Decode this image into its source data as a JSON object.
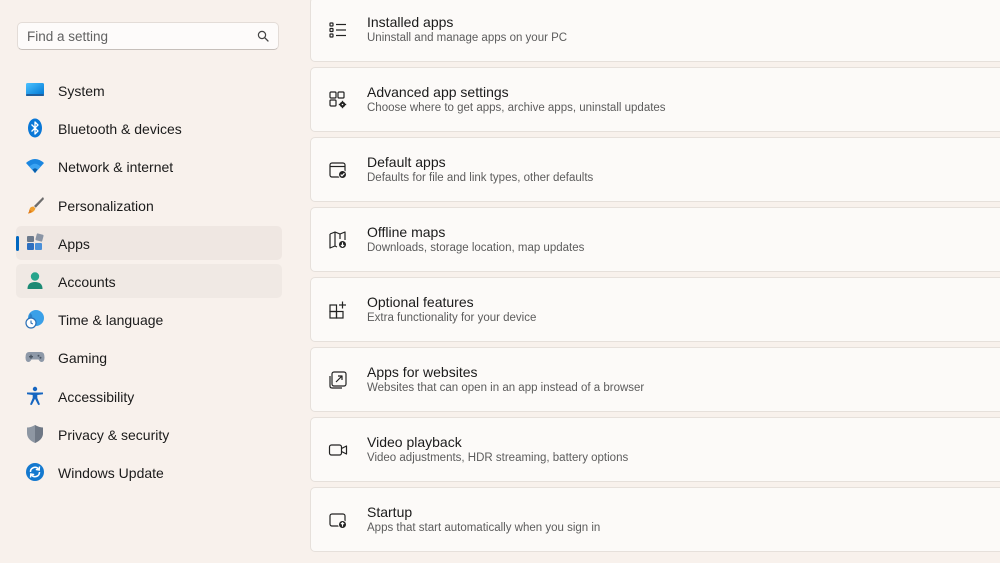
{
  "search": {
    "placeholder": "Find a setting"
  },
  "sidebar": {
    "items": [
      {
        "label": "System",
        "icon": "monitor-icon"
      },
      {
        "label": "Bluetooth & devices",
        "icon": "bluetooth-icon"
      },
      {
        "label": "Network & internet",
        "icon": "wifi-icon"
      },
      {
        "label": "Personalization",
        "icon": "brush-icon"
      },
      {
        "label": "Apps",
        "icon": "apps-icon",
        "selected": true
      },
      {
        "label": "Accounts",
        "icon": "person-icon"
      },
      {
        "label": "Time & language",
        "icon": "globe-clock-icon"
      },
      {
        "label": "Gaming",
        "icon": "gamepad-icon"
      },
      {
        "label": "Accessibility",
        "icon": "accessibility-icon"
      },
      {
        "label": "Privacy & security",
        "icon": "shield-icon"
      },
      {
        "label": "Windows Update",
        "icon": "update-icon"
      }
    ]
  },
  "main": {
    "cards": [
      {
        "title": "Installed apps",
        "desc": "Uninstall and manage apps on your PC",
        "icon": "list-icon"
      },
      {
        "title": "Advanced app settings",
        "desc": "Choose where to get apps, archive apps, uninstall updates",
        "icon": "apps-gear-icon"
      },
      {
        "title": "Default apps",
        "desc": "Defaults for file and link types, other defaults",
        "icon": "window-check-icon"
      },
      {
        "title": "Offline maps",
        "desc": "Downloads, storage location, map updates",
        "icon": "map-download-icon"
      },
      {
        "title": "Optional features",
        "desc": "Extra functionality for your device",
        "icon": "grid-plus-icon"
      },
      {
        "title": "Apps for websites",
        "desc": "Websites that can open in an app instead of a browser",
        "icon": "open-link-icon"
      },
      {
        "title": "Video playback",
        "desc": "Video adjustments, HDR streaming, battery options",
        "icon": "video-icon"
      },
      {
        "title": "Startup",
        "desc": "Apps that start automatically when you sign in",
        "icon": "startup-icon"
      }
    ]
  },
  "colors": {
    "accent": "#0067c0",
    "background": "#f8f1ec",
    "card": "#fcfaf8"
  }
}
